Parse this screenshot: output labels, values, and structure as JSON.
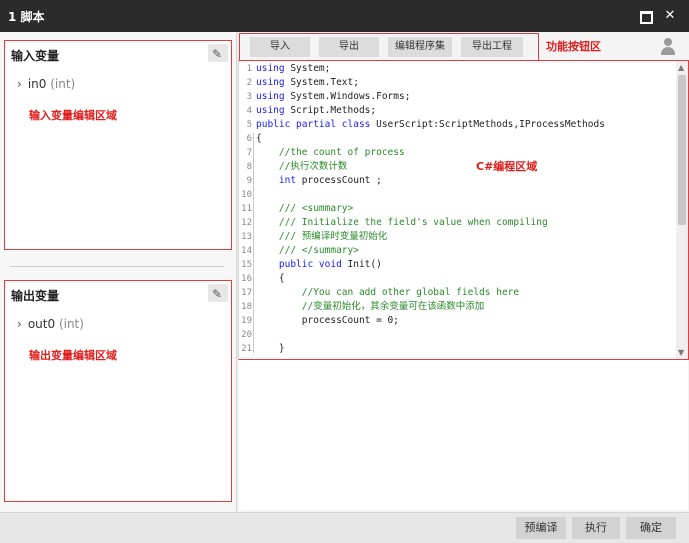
{
  "window": {
    "title": "1 脚本",
    "maximize_icon": "maximize-icon",
    "close_icon": "close-icon"
  },
  "input_panel": {
    "title": "输入变量",
    "var_name": "in0",
    "var_type": "(int)",
    "note": "输入变量编辑区域",
    "edit_icon": "pencil-icon"
  },
  "output_panel": {
    "title": "输出变量",
    "var_name": "out0",
    "var_type": "(int)",
    "note": "输出变量编辑区域",
    "edit_icon": "pencil-icon"
  },
  "toolbar": {
    "import": "导入",
    "export": "导出",
    "edit_assembly": "编辑程序集",
    "export_project": "导出工程",
    "note": "功能按钮区",
    "user_icon": "user-icon"
  },
  "editor": {
    "note": "C#编程区域",
    "line_numbers": [
      "1",
      "2",
      "3",
      "4",
      "5",
      "6",
      "7",
      "8",
      "9",
      "10",
      "11",
      "12",
      "13",
      "14",
      "15",
      "16",
      "17",
      "18",
      "19",
      "20",
      "21"
    ],
    "lines": [
      [
        [
          "kw",
          "using"
        ],
        [
          "tx",
          " System;"
        ]
      ],
      [
        [
          "kw",
          "using"
        ],
        [
          "tx",
          " System.Text;"
        ]
      ],
      [
        [
          "kw",
          "using"
        ],
        [
          "tx",
          " System.Windows.Forms;"
        ]
      ],
      [
        [
          "kw",
          "using"
        ],
        [
          "tx",
          " Script.Methods;"
        ]
      ],
      [
        [
          "kw",
          "public partial class"
        ],
        [
          "tx",
          " UserScript:ScriptMethods,IProcessMethods"
        ]
      ],
      [
        [
          "tx",
          "{"
        ]
      ],
      [
        [
          "cm",
          "    //the count of process"
        ]
      ],
      [
        [
          "cm",
          "    //执行次数计数"
        ]
      ],
      [
        [
          "kw",
          "    int"
        ],
        [
          "tx",
          " processCount ;"
        ]
      ],
      [
        [
          "tx",
          ""
        ]
      ],
      [
        [
          "cm",
          "    /// <summary>"
        ]
      ],
      [
        [
          "cm",
          "    /// Initialize the field's value when compiling"
        ]
      ],
      [
        [
          "cm",
          "    /// 预编译时变量初始化"
        ]
      ],
      [
        [
          "cm",
          "    /// </summary>"
        ]
      ],
      [
        [
          "kw",
          "    public void"
        ],
        [
          "tx",
          " Init()"
        ]
      ],
      [
        [
          "tx",
          "    {"
        ]
      ],
      [
        [
          "cm",
          "        //You can add other global fields here"
        ]
      ],
      [
        [
          "cm",
          "        //变量初始化，其余变量可在该函数中添加"
        ]
      ],
      [
        [
          "tx",
          "        processCount = 0;"
        ]
      ],
      [
        [
          "tx",
          ""
        ]
      ],
      [
        [
          "tx",
          "    }"
        ]
      ]
    ]
  },
  "footer": {
    "precompile": "预编译",
    "execute": "执行",
    "confirm": "确定"
  }
}
